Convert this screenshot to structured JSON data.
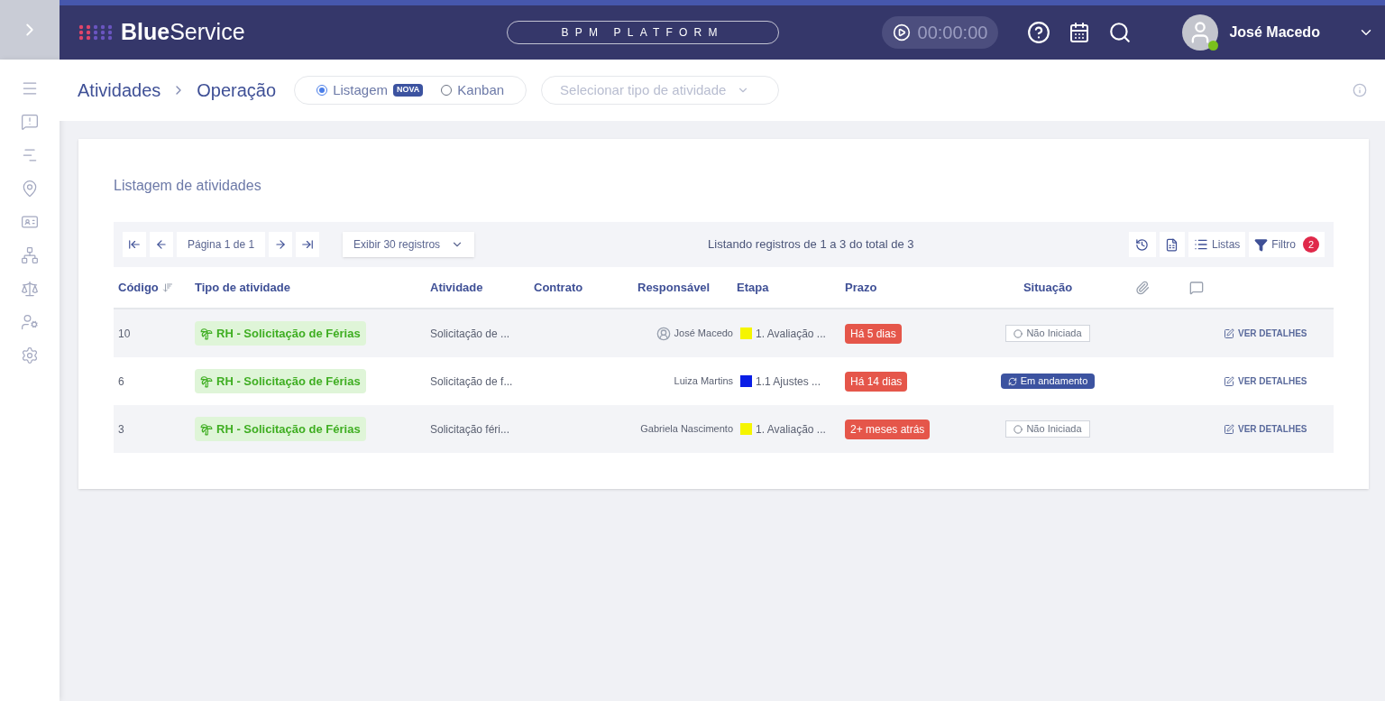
{
  "header": {
    "logo_bold": "Blue",
    "logo_light": "Service",
    "platform": "BPM PLATFORM",
    "timer": "00:00:00",
    "user": {
      "name": "José Macedo",
      "online": true
    }
  },
  "breadcrumb": [
    "Atividades",
    "Operação"
  ],
  "view_modes": [
    {
      "label": "Listagem",
      "selected": true,
      "badge": "NOVA"
    },
    {
      "label": "Kanban",
      "selected": false
    }
  ],
  "activity_type_select": {
    "placeholder": "Selecionar tipo de atividade"
  },
  "card": {
    "title": "Listagem de atividades"
  },
  "toolbar": {
    "page": "Página 1 de 1",
    "page_size": "Exibir 30 registros",
    "summary": "Listando registros de 1 a 3 do total de 3",
    "lists": "Listas",
    "filter": "Filtro",
    "filter_count": "2"
  },
  "table": {
    "columns": [
      "Código",
      "Tipo de atividade",
      "Atividade",
      "Contrato",
      "Responsável",
      "Etapa",
      "Prazo",
      "Situação"
    ],
    "rows": [
      {
        "code": "10",
        "type": "RH - Solicitação de Férias",
        "activity": "Solicitação de ...",
        "responsible": "José Macedo",
        "avatar": true,
        "stage": {
          "label": "1. Avaliação ...",
          "color": "#f5f500"
        },
        "deadline": "Há 5 dias",
        "status": {
          "label": "Não Iniciada",
          "kind": "not_started"
        },
        "action": "VER DETALHES"
      },
      {
        "code": "6",
        "type": "RH - Solicitação de Férias",
        "activity": "Solicitação de f...",
        "responsible": "Luiza Martins",
        "avatar": false,
        "stage": {
          "label": "1.1 Ajustes ...",
          "color": "#0a1ee6"
        },
        "deadline": "Há 14 dias",
        "status": {
          "label": "Em andamento",
          "kind": "in_progress"
        },
        "action": "VER DETALHES"
      },
      {
        "code": "3",
        "type": "RH - Solicitação de Férias",
        "activity": "Solicitação féri...",
        "responsible": "Gabriela Nascimento",
        "avatar": false,
        "stage": {
          "label": "1. Avaliação ...",
          "color": "#f5f500"
        },
        "deadline": "2+ meses atrás",
        "status": {
          "label": "Não Iniciada",
          "kind": "not_started"
        },
        "action": "VER DETALHES"
      }
    ]
  }
}
